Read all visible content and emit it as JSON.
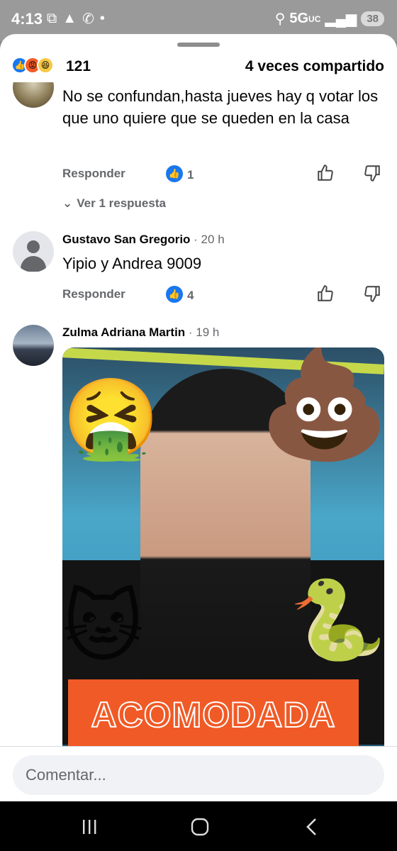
{
  "status_bar": {
    "time": "4:13",
    "network": "5G",
    "network_suffix": "UC",
    "battery": "38"
  },
  "summary": {
    "reaction_count": "121",
    "shares": "4 veces compartido"
  },
  "comments": [
    {
      "text": "No se confundan,hasta jueves hay q votar los que uno quiere que se queden en la casa",
      "reply_label": "Responder",
      "like_count": "1",
      "view_replies": "Ver 1 respuesta"
    },
    {
      "author": "Gustavo San Gregorio",
      "time": "· 20 h",
      "text": "Yipio y Andrea 9009",
      "reply_label": "Responder",
      "like_count": "4"
    },
    {
      "author": "Zulma Adriana Martin",
      "time": "· 19 h",
      "image_caption": "ACOMODADA"
    }
  ],
  "composer": {
    "placeholder": "Comentar..."
  },
  "colors": {
    "brand_blue": "#1877f2",
    "secondary_text": "#65676b",
    "caption_orange": "#f05a26"
  }
}
